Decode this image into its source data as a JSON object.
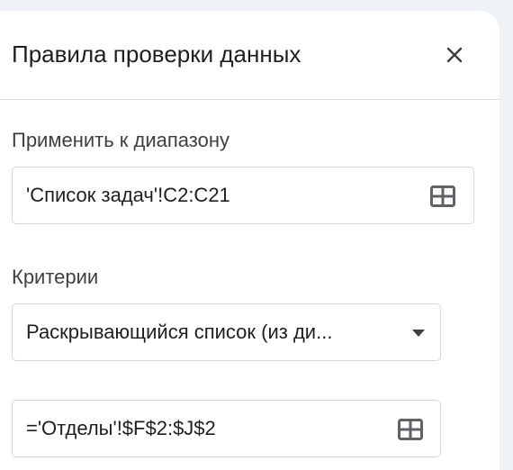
{
  "dialog": {
    "title": "Правила проверки данных",
    "close_icon": "close-icon"
  },
  "range_section": {
    "label": "Применить к диапазону",
    "value": "'Список задач'!C2:C21",
    "picker_icon": "grid-select-icon"
  },
  "criteria_section": {
    "label": "Критерии",
    "selected": "Раскрывающийся список (из ди...",
    "dropdown_icon": "triangle-down-icon",
    "source_value": "='Отделы'!$F$2:$J$2",
    "picker_icon": "grid-select-icon"
  },
  "colors": {
    "icon_gray": "#5f6368",
    "border": "#d4d7db",
    "divider": "#dcdfe3",
    "background": "#eef1f5"
  }
}
